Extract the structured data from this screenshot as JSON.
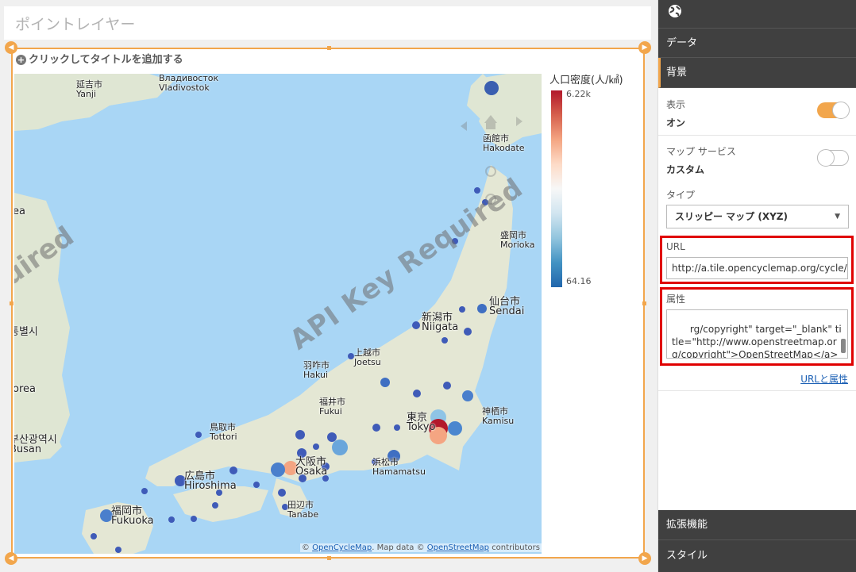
{
  "sheet": {
    "title": "ポイントレイヤー"
  },
  "viz": {
    "add_title_label": "クリックしてタイトルを追加する"
  },
  "map": {
    "watermark": "API Key Required",
    "attribution": {
      "prefix": "©",
      "cycle_link": "OpenCycleMap",
      "middle": ". Map data ©",
      "osm_link": "OpenStreetMap",
      "suffix": "contributors"
    },
    "labels": [
      {
        "text": "延吉市",
        "sub": "Yanji"
      },
      {
        "text": "Владивосток",
        "sub": "Vladivostok"
      },
      {
        "text": "函館市",
        "sub": "Hakodate"
      },
      {
        "text": "盛岡市",
        "sub": "Morioka"
      },
      {
        "text": "仙台市",
        "sub": "Sendai"
      },
      {
        "text": "新潟市",
        "sub": "Niigata"
      },
      {
        "text": "上越市",
        "sub": "Joetsu"
      },
      {
        "text": "羽咋市",
        "sub": "Hakui"
      },
      {
        "text": "福井市",
        "sub": "Fukui"
      },
      {
        "text": "鳥取市",
        "sub": "Tottori"
      },
      {
        "text": "東京",
        "sub": "Tokyo"
      },
      {
        "text": "神栖市",
        "sub": "Kamisu"
      },
      {
        "text": "大阪市",
        "sub": "Osaka"
      },
      {
        "text": "浜松市",
        "sub": "Hamamatsu"
      },
      {
        "text": "広島市",
        "sub": "Hiroshima"
      },
      {
        "text": "田辺市",
        "sub": "Tanabe"
      },
      {
        "text": "福岡市",
        "sub": "Fukuoka"
      },
      {
        "text": "부산광역시",
        "sub": "Busan"
      },
      {
        "text": "orea",
        "sub": ""
      },
      {
        "text": "ea",
        "sub": ""
      },
      {
        "text": "통별시",
        "sub": ""
      }
    ]
  },
  "legend": {
    "title": "人口密度(人/㎢)",
    "max": "6.22k",
    "min": "64.16"
  },
  "panel": {
    "data_section": "データ",
    "background_section": "背景",
    "display_label": "表示",
    "display_value": "オン",
    "map_service_label": "マップ サービス",
    "map_service_value": "カスタム",
    "type_label": "タイプ",
    "type_value": "スリッピー マップ (XYZ)",
    "url_label": "URL",
    "url_value": "http://a.tile.opencyclemap.org/cycle/$",
    "attribution_label": "属性",
    "attribution_value": "rg/copyright\" target=\"_blank\" title=\"http://www.openstreetmap.org/copyright\">OpenStreetMap</a> contributors",
    "url_attr_link": "URLと属性",
    "extensions_section": "拡張機能",
    "style_section": "スタイル"
  },
  "colors": {
    "accent": "#f2a64c",
    "highlight_box": "#e00000",
    "dark_row": "#404040",
    "water": "#a9d6f5",
    "land": "#dfe6d3"
  }
}
